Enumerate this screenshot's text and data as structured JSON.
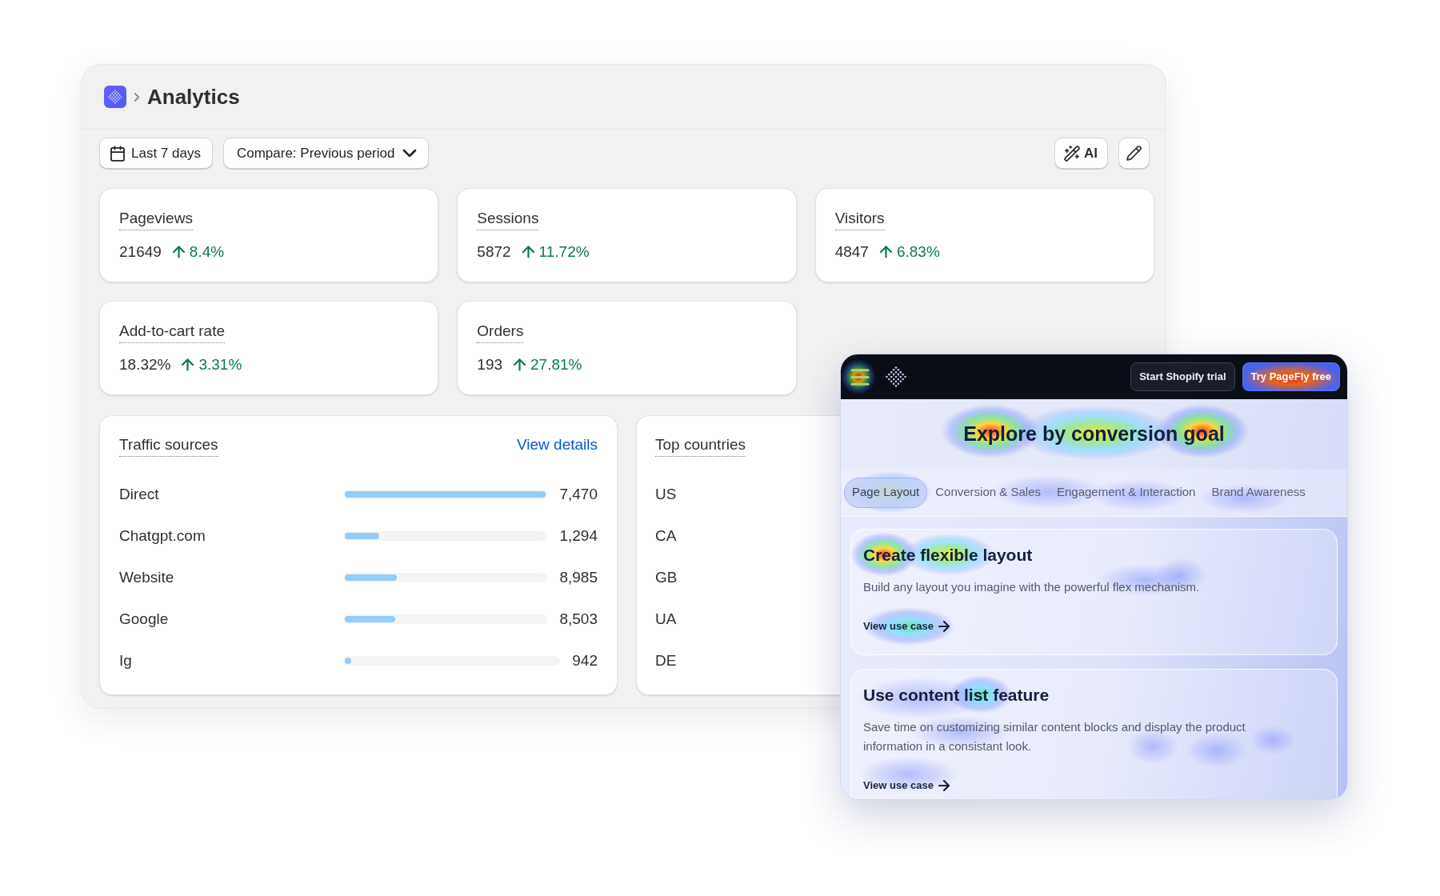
{
  "header": {
    "title": "Analytics"
  },
  "toolbar": {
    "date_range": "Last 7 days",
    "compare": "Compare: Previous period",
    "ai_button": "AI"
  },
  "metrics": [
    {
      "label": "Pageviews",
      "value": "21649",
      "change": "8.4%",
      "up": true
    },
    {
      "label": "Sessions",
      "value": "5872",
      "change": "11.72%",
      "up": true
    },
    {
      "label": "Visitors",
      "value": "4847",
      "change": "6.83%",
      "up": true
    },
    {
      "label": "Add-to-cart rate",
      "value": "18.32%",
      "change": "3.31%",
      "up": true
    },
    {
      "label": "Orders",
      "value": "193",
      "change": "27.81%",
      "up": true
    }
  ],
  "traffic_sources": {
    "title": "Traffic sources",
    "link": "View details",
    "rows": [
      {
        "name": "Direct",
        "level": 1.0,
        "value": "7,470"
      },
      {
        "name": "Chatgpt.com",
        "level": 0.17,
        "value": "1,294"
      },
      {
        "name": "Website",
        "level": 0.26,
        "value": "8,985"
      },
      {
        "name": "Google",
        "level": 0.25,
        "value": "8,503"
      },
      {
        "name": "Ig",
        "level": 0.02,
        "value": "942"
      }
    ]
  },
  "top_countries": {
    "title": "Top countries",
    "rows": [
      {
        "name": "US"
      },
      {
        "name": "CA"
      },
      {
        "name": "GB"
      },
      {
        "name": "UA"
      },
      {
        "name": "DE"
      }
    ]
  },
  "website_preview": {
    "nav_buttons": [
      {
        "label": "Start Shopify trial",
        "kind": "secondary"
      },
      {
        "label": "Try PageFly free",
        "kind": "primary"
      }
    ],
    "heading": "Explore by conversion goal",
    "tabs": [
      {
        "label": "Page Layout",
        "selected": true
      },
      {
        "label": "Conversion & Sales",
        "selected": false
      },
      {
        "label": "Engagement & Interaction",
        "selected": false
      },
      {
        "label": "Brand Awareness",
        "selected": false
      }
    ],
    "cards": [
      {
        "title": "Create flexible layout",
        "description": "Build any layout you imagine with the powerful flex mechanism.",
        "link": "View use case"
      },
      {
        "title": "Use content list feature",
        "description": "Save time on customizing similar content blocks and display the product information in a consistant look.",
        "link": "View use case"
      }
    ]
  }
}
